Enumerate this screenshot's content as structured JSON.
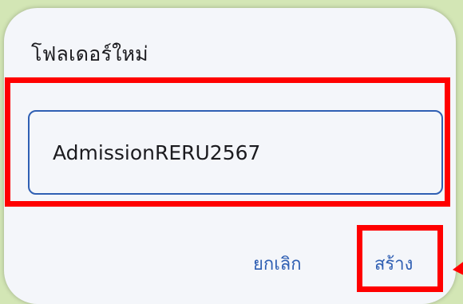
{
  "dialog": {
    "title": "โฟลเดอร์ใหม่",
    "input": {
      "value": "AdmissionRERU2567"
    },
    "buttons": {
      "cancel_label": "ยกเลิก",
      "create_label": "สร้าง"
    }
  },
  "colors": {
    "background": "#d3e6b5",
    "dialog_bg": "#f4f6fa",
    "accent": "#2f5fb3",
    "highlight": "#ff0000",
    "text": "#1b1b1f"
  },
  "icons": [
    "annotation-arrow-icon"
  ]
}
